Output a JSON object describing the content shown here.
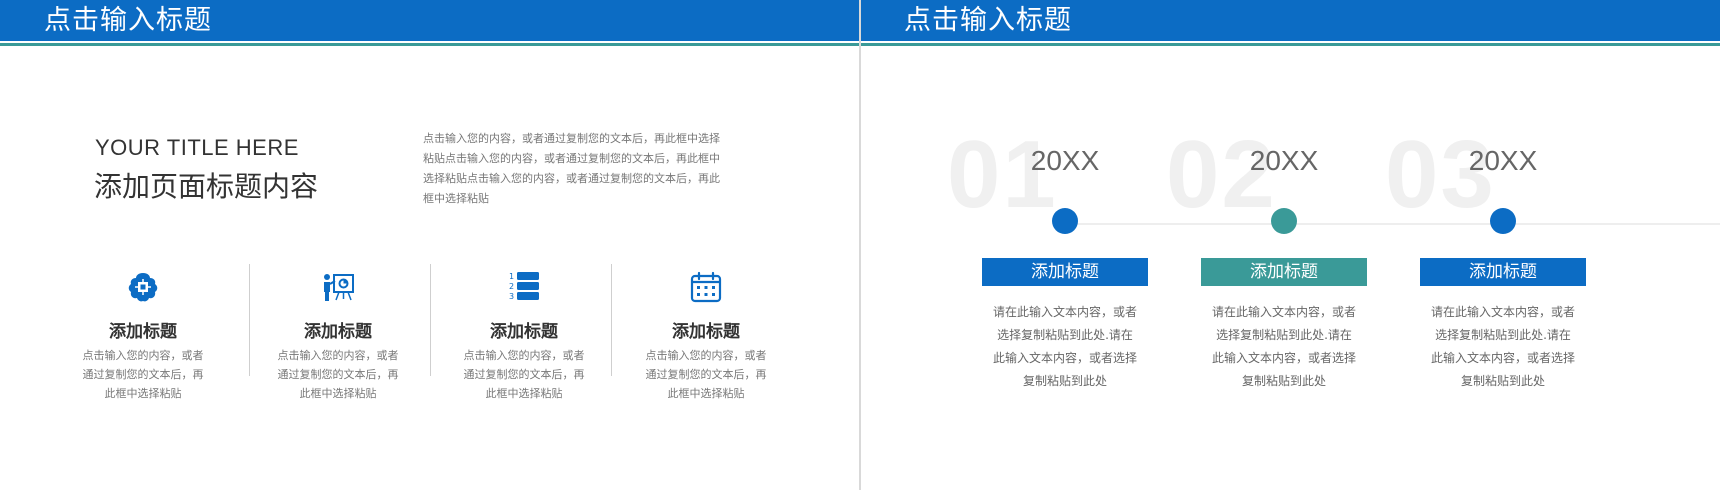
{
  "colors": {
    "blue": "#0c6cc4",
    "teal": "#3a9a98"
  },
  "left": {
    "header_title": "点击输入标题",
    "en_title": "YOUR TITLE HERE",
    "cn_title": "添加页面标题内容",
    "intro_lines": [
      "点击输入您的内容，或者通过复制您的文本后，再此框中选择",
      "粘贴点击输入您的内容，或者通过复制您的文本后，再此框中",
      "选择粘贴点击输入您的内容，或者通过复制您的文本后，再此",
      "框中选择粘贴"
    ],
    "features": [
      {
        "icon": "brain-icon",
        "title": "添加标题",
        "desc_lines": [
          "点击输入您的内容，或者",
          "通过复制您的文本后，再",
          "此框中选择粘贴"
        ]
      },
      {
        "icon": "presentation-icon",
        "title": "添加标题",
        "desc_lines": [
          "点击输入您的内容，或者",
          "通过复制您的文本后，再",
          "此框中选择粘贴"
        ]
      },
      {
        "icon": "numbered-list-icon",
        "title": "添加标题",
        "desc_lines": [
          "点击输入您的内容，或者",
          "通过复制您的文本后，再",
          "此框中选择粘贴"
        ]
      },
      {
        "icon": "calendar-icon",
        "title": "添加标题",
        "desc_lines": [
          "点击输入您的内容，或者",
          "通过复制您的文本后，再",
          "此框中选择粘贴"
        ]
      }
    ],
    "list_icon_numbers": [
      "1",
      "2",
      "3"
    ]
  },
  "right": {
    "header_title": "点击输入标题",
    "steps": [
      {
        "num": "01",
        "year": "20XX",
        "label": "添加标题",
        "color": "#0c6cc4",
        "desc_lines": [
          "请在此输入文本内容，或者",
          "选择复制粘贴到此处.请在",
          "此输入文本内容，或者选择",
          "复制粘贴到此处"
        ]
      },
      {
        "num": "02",
        "year": "20XX",
        "label": "添加标题",
        "color": "#3a9a98",
        "desc_lines": [
          "请在此输入文本内容，或者",
          "选择复制粘贴到此处.请在",
          "此输入文本内容，或者选择",
          "复制粘贴到此处"
        ]
      },
      {
        "num": "03",
        "year": "20XX",
        "label": "添加标题",
        "color": "#0c6cc4",
        "desc_lines": [
          "请在此输入文本内容，或者",
          "选择复制粘贴到此处.请在",
          "此输入文本内容，或者选择",
          "复制粘贴到此处"
        ]
      }
    ]
  }
}
